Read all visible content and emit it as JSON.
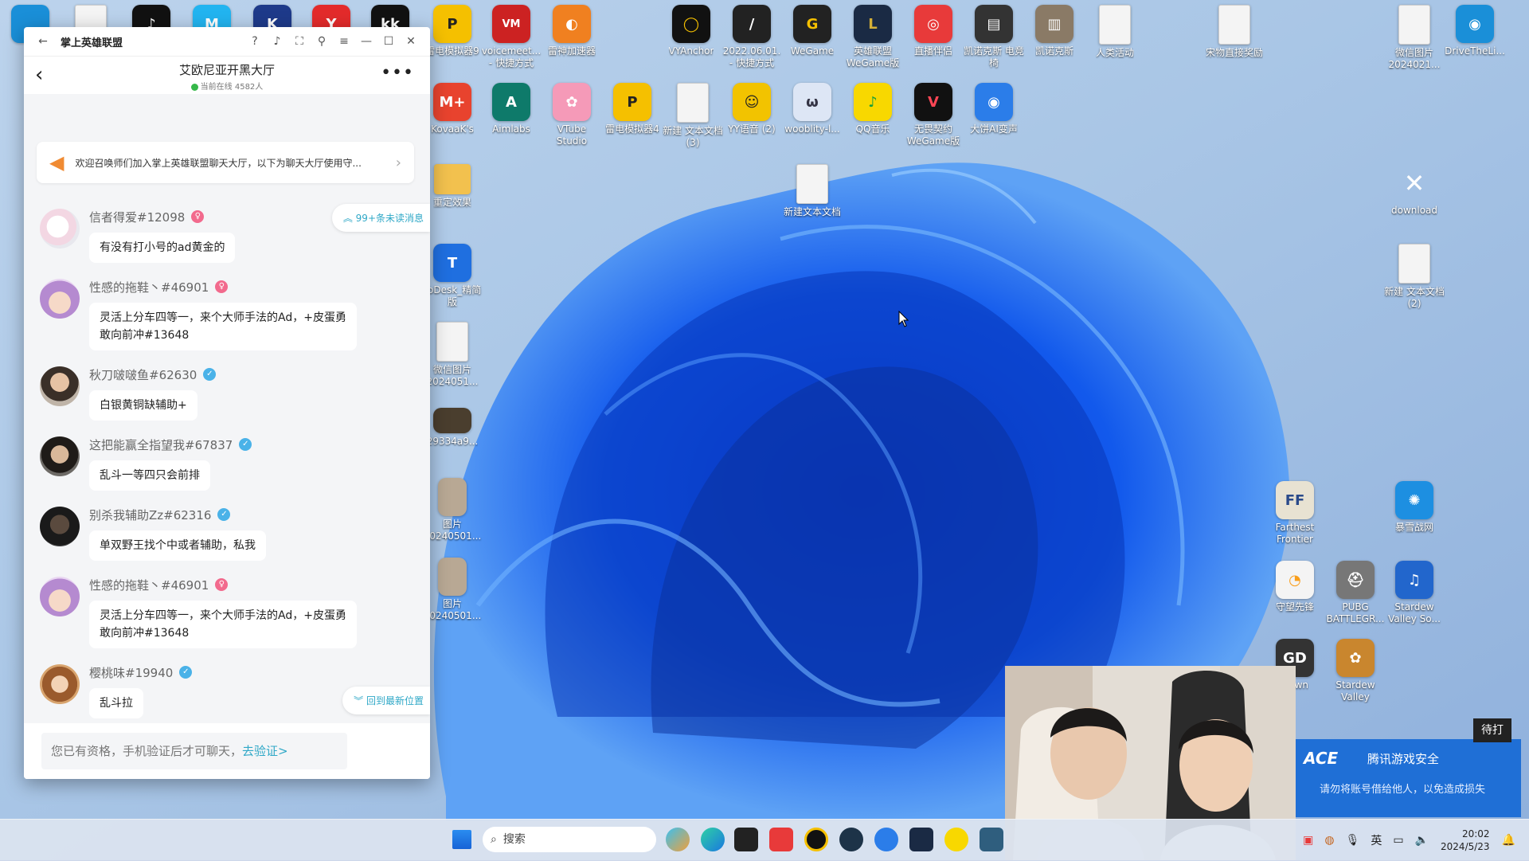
{
  "chat_window": {
    "app_title": "掌上英雄联盟",
    "room_name": "艾欧尼亚开黑大厅",
    "online_text": "当前在线 4582人",
    "announcement": "欢迎召唤师们加入掌上英雄联盟聊天大厅，以下为聊天大厅使用守...",
    "unread_label": "99+条未读消息",
    "latest_label": "回到最新位置",
    "input_placeholder": "您已有资格，手机验证后才可聊天，",
    "verify_link": "去验证>",
    "messages": [
      {
        "user": "信者得爱#12098",
        "badge": "female",
        "text": "有没有打小号的ad黄金的"
      },
      {
        "user": "性感的拖鞋丶#46901",
        "badge": "female",
        "text": "灵活上分车四等一，来个大师手法的Ad，+皮蛋勇敢向前冲#13648"
      },
      {
        "user": "秋刀啵啵鱼#62630",
        "badge": "verified",
        "text": "白银黄铜缺辅助+"
      },
      {
        "user": "这把能赢全指望我#67837",
        "badge": "verified",
        "text": "乱斗一等四只会前排"
      },
      {
        "user": "别杀我辅助Zz#62316",
        "badge": "verified",
        "text": "单双野王找个中或者辅助，私我"
      },
      {
        "user": "性感的拖鞋丶#46901",
        "badge": "female",
        "text": "灵活上分车四等一，来个大师手法的Ad，+皮蛋勇敢向前冲#13648"
      },
      {
        "user": "樱桃味#19940",
        "badge": "verified",
        "text": "乱斗拉"
      }
    ]
  },
  "desktop_icons": [
    {
      "label": "",
      "color": "#1a8fd8",
      "glyph": ""
    },
    {
      "label": "",
      "color": "#f4f4f4",
      "glyph": ""
    },
    {
      "label": "",
      "color": "#111111",
      "glyph": "♪"
    },
    {
      "label": "",
      "color": "#22b4f0",
      "glyph": "M"
    },
    {
      "label": "",
      "color": "#1e3a8a",
      "glyph": "K"
    },
    {
      "label": "",
      "color": "#e32b2b",
      "glyph": "Y"
    },
    {
      "label": "",
      "color": "#111111",
      "glyph": "kk"
    },
    {
      "label": "雷电模拟器9",
      "color": "#f5c000",
      "glyph": "P"
    },
    {
      "label": "voicemeet... - 快捷方式",
      "color": "#cc2222",
      "glyph": "VM"
    },
    {
      "label": "雷神加速器",
      "color": "#f08020",
      "glyph": "◐"
    },
    {
      "label": "VYAnchor",
      "color": "#111111",
      "glyph": "◯"
    },
    {
      "label": "2022.06.01. - 快捷方式",
      "color": "#222222",
      "glyph": "/"
    },
    {
      "label": "WeGame",
      "color": "#222222",
      "glyph": "G"
    },
    {
      "label": "英雄联盟 WeGame版",
      "color": "#1a2a44",
      "glyph": "L"
    },
    {
      "label": "直播伴侣",
      "color": "#e83a3a",
      "glyph": "◎"
    },
    {
      "label": "凯诺克斯 电竞椅",
      "color": "#333333",
      "glyph": "▤"
    },
    {
      "label": "凯诺克斯",
      "color": "#8a7a66",
      "glyph": "▥"
    },
    {
      "label": "人类活动",
      "color": "#f4f4f4",
      "glyph": ""
    },
    {
      "label": "宋物直接奖励",
      "color": "#f4f4f4",
      "glyph": ""
    },
    {
      "label": "微信图片 2024021...",
      "color": "#f4f4f4",
      "glyph": ""
    },
    {
      "label": "DriveTheLi...",
      "color": "#1a8fd8",
      "glyph": "◉"
    },
    {
      "label": "KovaaK's",
      "color": "#e8432e",
      "glyph": "M+"
    },
    {
      "label": "Aimlabs",
      "color": "#0e7a6a",
      "glyph": "A"
    },
    {
      "label": "VTube Studio",
      "color": "#f59ab8",
      "glyph": "✿"
    },
    {
      "label": "雷电模拟器4",
      "color": "#f5c000",
      "glyph": "P"
    },
    {
      "label": "新建 文本文档 (3)",
      "color": "#f4f4f4",
      "glyph": ""
    },
    {
      "label": "YY语音 (2)",
      "color": "#f2c300",
      "glyph": "☺"
    },
    {
      "label": "wooblity-l...",
      "color": "#dde6f5",
      "glyph": "ω"
    },
    {
      "label": "QQ音乐",
      "color": "#f8d800",
      "glyph": "♪"
    },
    {
      "label": "无畏契约 WeGame版",
      "color": "#111111",
      "glyph": "V"
    },
    {
      "label": "大饼AI变声",
      "color": "#2b7de9",
      "glyph": "◉"
    },
    {
      "label": "重定效果",
      "color": "#f2c14e",
      "glyph": ""
    },
    {
      "label": "新建文本文档",
      "color": "#f4f4f4",
      "glyph": ""
    },
    {
      "label": "download",
      "color": "",
      "glyph": "✕"
    },
    {
      "label": "ToDesk_精简版",
      "color": "#1f6fe0",
      "glyph": "T"
    },
    {
      "label": "新建 文本文档 (2)",
      "color": "#f4f4f4",
      "glyph": ""
    },
    {
      "label": "微信图片 2024051...",
      "color": "#f4f4f4",
      "glyph": ""
    },
    {
      "label": "29334a9...",
      "color": "#4a3e2e",
      "glyph": ""
    },
    {
      "label": "图片 20240501...",
      "color": "#b8a894",
      "glyph": ""
    },
    {
      "label": "图片 20240501...",
      "color": "#b8a894",
      "glyph": ""
    },
    {
      "label": "Farthest Frontier",
      "color": "#e8e2d2",
      "glyph": "FF"
    },
    {
      "label": "暴雪战网",
      "color": "#1d8fe1",
      "glyph": "✺"
    },
    {
      "label": "守望先锋",
      "color": "#f4f4f4",
      "glyph": "◔"
    },
    {
      "label": "PUBG BATTLEGR...",
      "color": "#777777",
      "glyph": "⛑"
    },
    {
      "label": "Stardew Valley So...",
      "color": "#2266cc",
      "glyph": "♫"
    },
    {
      "label": "Dawn",
      "color": "#333333",
      "glyph": "GD"
    },
    {
      "label": "Stardew Valley",
      "color": "#c9862e",
      "glyph": "✿"
    }
  ],
  "ace": {
    "brand": "ACE",
    "title": "腾讯游戏安全",
    "body": "请勿将账号借给他人，以免造成损失",
    "corner": "待打"
  },
  "taskbar": {
    "search_label": "搜索",
    "lang": "英",
    "time": "20:02",
    "date": "2024/5/23"
  }
}
